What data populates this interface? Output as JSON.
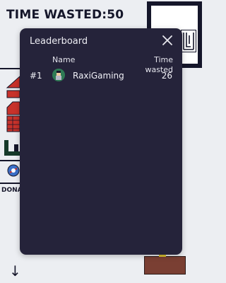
{
  "hud": {
    "timer_label": "TIME WASTED:50"
  },
  "side": {
    "donate_label": "DONA",
    "down_arrow": "↓"
  },
  "leaderboard": {
    "title": "Leaderboard",
    "columns": {
      "name": "Name",
      "time": "Time wasted"
    },
    "rows": [
      {
        "rank": "#1",
        "name": "RaxiGaming",
        "time": "26"
      }
    ]
  },
  "colors": {
    "background": "#eceef2",
    "modal": "#25233a",
    "dark": "#15162a",
    "brick": "#c8322b",
    "chest": "#7a3f33"
  }
}
